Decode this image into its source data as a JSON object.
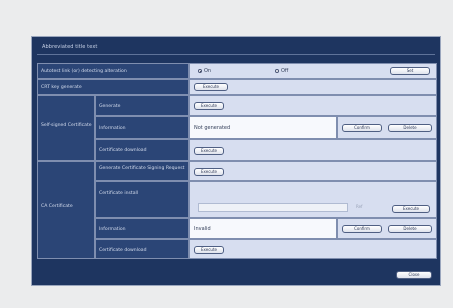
{
  "panel": {
    "title": "Abbreviated title text",
    "rows": {
      "auto_reboot_label": "Autotest link (or) detecting alteration",
      "radio_on_label": "On",
      "radio_off_label": "Off",
      "set_label": "Set",
      "crt_key_label": "CRT key generate",
      "execute_label": "Execute",
      "self_signed_label": "Self-signed Certificate",
      "generate_label": "Generate",
      "information_label": "Information",
      "info_value": "Not generated",
      "confirm_label": "Confirm",
      "delete_label": "Delete",
      "cert_download_label": "Certificate download",
      "ca_cert_label": "CA Certificate",
      "csr_label": "Generate Certificate Signing Request",
      "cert_install_label": "Certificate install",
      "file_hint": "Ref",
      "ca_info_value": "Invalid"
    },
    "close_label": "Close"
  }
}
